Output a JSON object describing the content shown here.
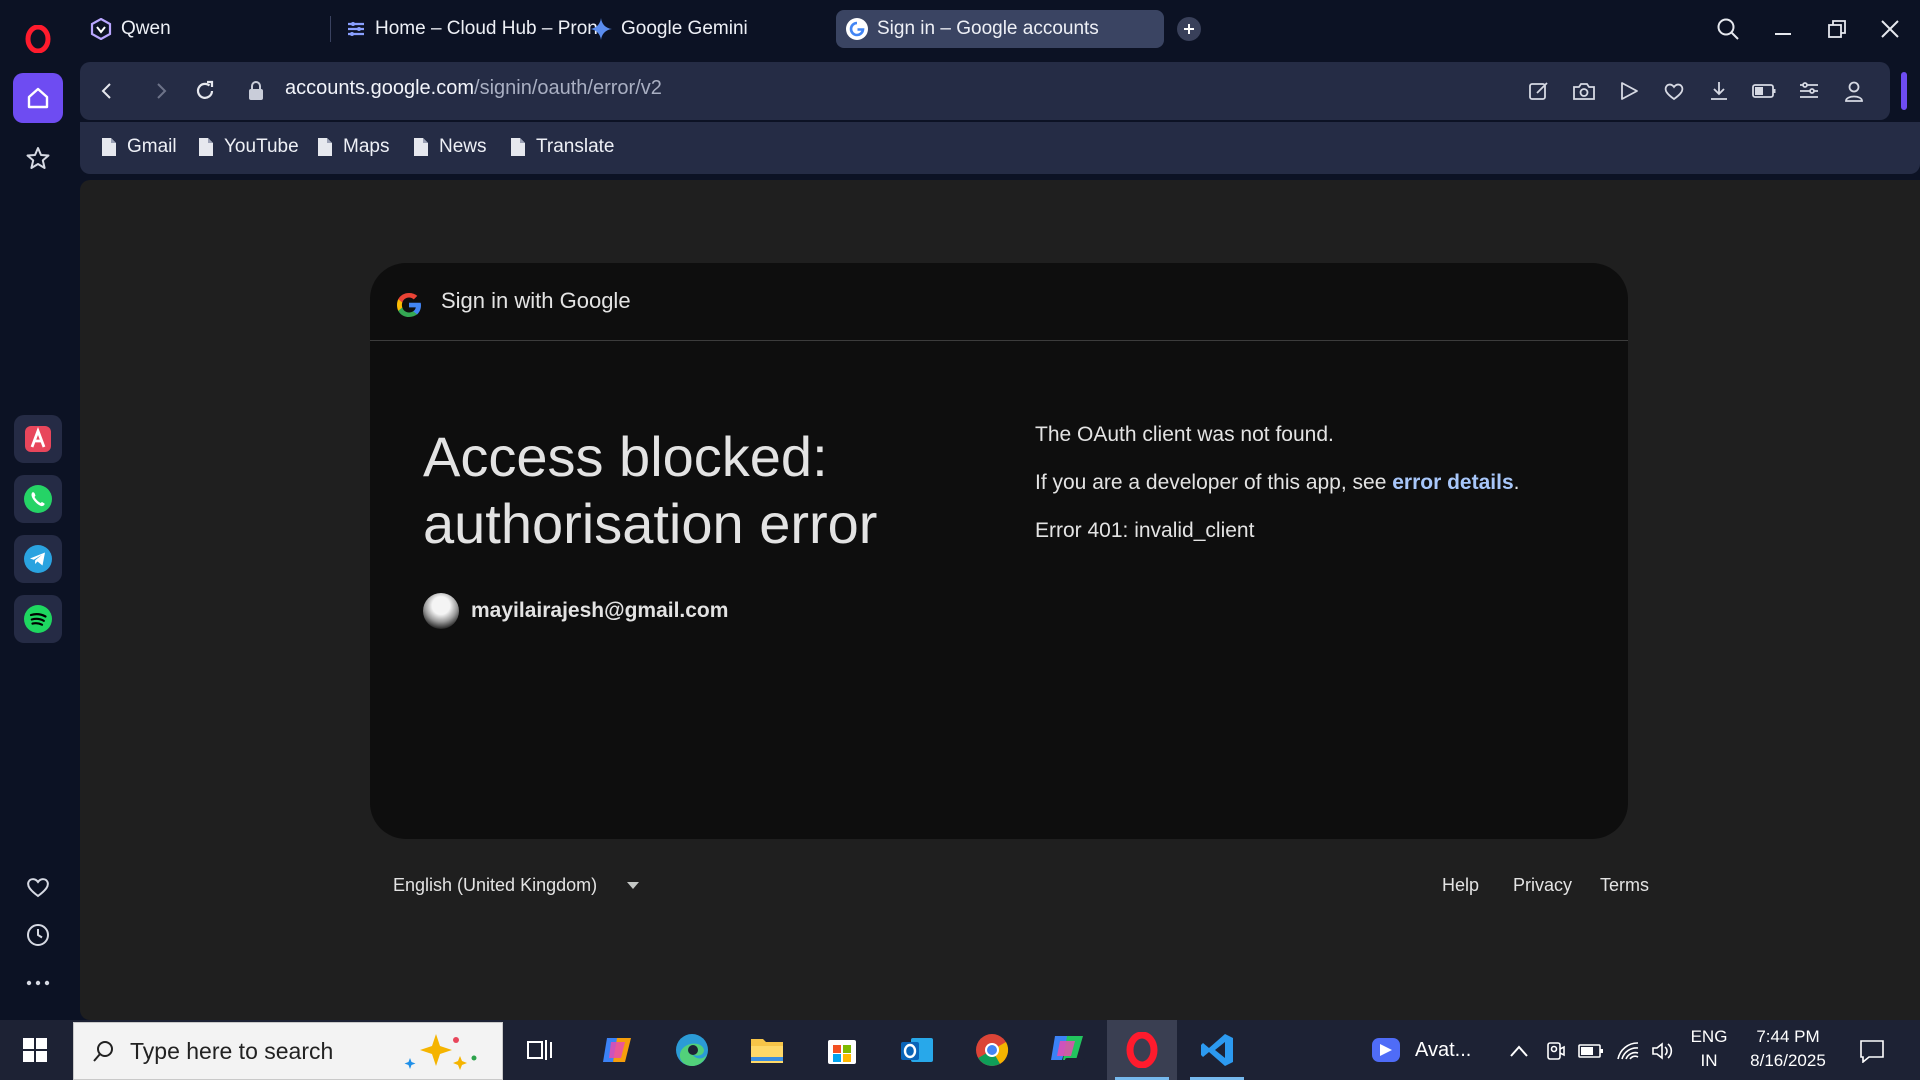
{
  "tabs": [
    {
      "title": "Qwen",
      "icon": "qwen-icon",
      "active": false
    },
    {
      "title": "Home – Cloud Hub – Pron",
      "icon": "cloudhub-icon",
      "active": false
    },
    {
      "title": "Google Gemini",
      "icon": "gemini-icon",
      "active": false
    },
    {
      "title": "Sign in – Google accounts",
      "icon": "google-icon",
      "active": true
    }
  ],
  "address": {
    "host": "accounts.google.com",
    "path": "/signin/oauth/error/v2"
  },
  "bookmarks": [
    {
      "label": "Gmail"
    },
    {
      "label": "YouTube"
    },
    {
      "label": "Maps"
    },
    {
      "label": "News"
    },
    {
      "label": "Translate"
    }
  ],
  "sidebar_apps": [
    "aria-icon",
    "whatsapp-icon",
    "telegram-icon",
    "spotify-icon"
  ],
  "page": {
    "header_title": "Sign in with Google",
    "heading": "Access blocked: authorisation error",
    "account_email": "mayilairajesh@gmail.com",
    "message_1": "The OAuth client was not found.",
    "message_2_before": "If you are a developer of this app, see ",
    "message_2_link": "error details",
    "message_2_after": ".",
    "error_code": "Error 401: invalid_client",
    "language": "English (United Kingdom)",
    "footer_links": [
      "Help",
      "Privacy",
      "Terms"
    ]
  },
  "taskbar": {
    "search_placeholder": "Type here to search",
    "zoom_label": "Avat...",
    "lang_top": "ENG",
    "lang_bottom": "IN",
    "time": "7:44 PM",
    "date": "8/16/2025"
  },
  "colors": {
    "accent": "#6e4cf2",
    "link": "#a8c7fa",
    "card": "#0e0e0e",
    "page": "#1f1f1f"
  }
}
